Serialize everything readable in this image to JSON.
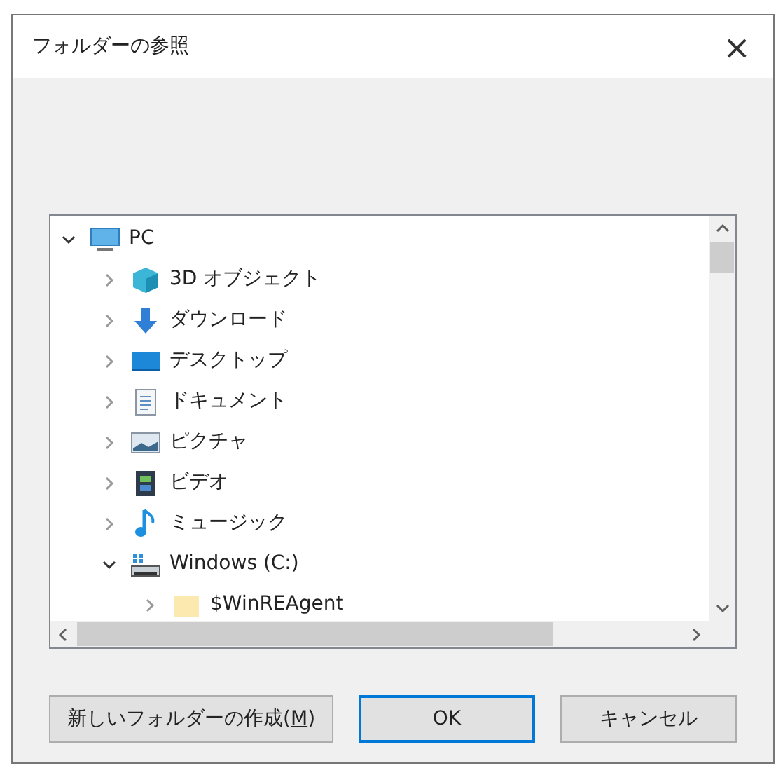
{
  "window": {
    "title": "フォルダーの参照",
    "close": "×"
  },
  "tree": {
    "items": [
      {
        "label": "PC",
        "kind": "pc",
        "expanded": true,
        "children": [
          {
            "label": "3D オブジェクト",
            "kind": "objects3d",
            "expanded": false
          },
          {
            "label": "ダウンロード",
            "kind": "download",
            "expanded": false
          },
          {
            "label": "デスクトップ",
            "kind": "desktop",
            "expanded": false
          },
          {
            "label": "ドキュメント",
            "kind": "documents",
            "expanded": false
          },
          {
            "label": "ピクチャ",
            "kind": "pictures",
            "expanded": false
          },
          {
            "label": "ビデオ",
            "kind": "videos",
            "expanded": false
          },
          {
            "label": "ミュージック",
            "kind": "music",
            "expanded": false
          },
          {
            "label": "Windows (C:)",
            "kind": "drive",
            "expanded": true,
            "children": [
              {
                "label": "$WinREAgent",
                "kind": "folder",
                "expanded": false
              }
            ]
          }
        ]
      }
    ]
  },
  "buttons": [
    {
      "label_before": "新しいフォルダーの作成(",
      "mnemonic": "M",
      "label_after": ")",
      "default": false
    },
    {
      "label_before": "OK",
      "default": true
    },
    {
      "label_before": "キャンセル",
      "default": false
    }
  ]
}
